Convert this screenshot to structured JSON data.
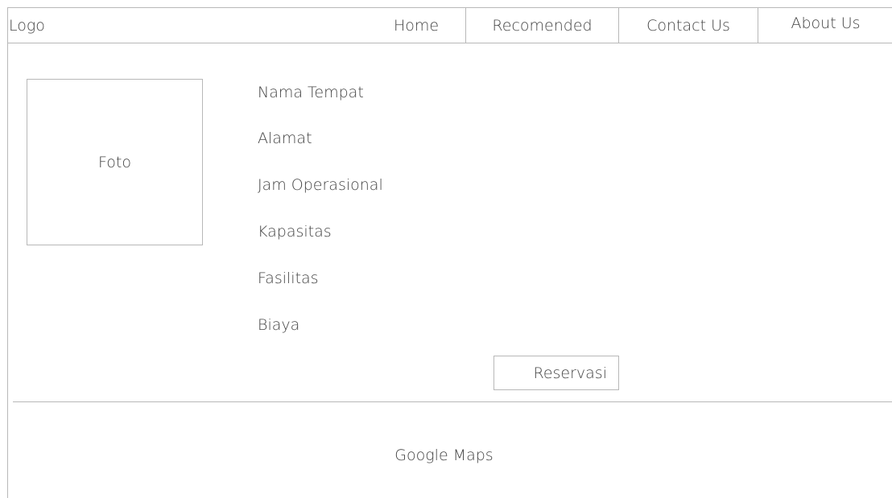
{
  "header": {
    "logo": "Logo",
    "nav": [
      {
        "label": "Home"
      },
      {
        "label": "Recomended"
      },
      {
        "label": "Contact Us"
      },
      {
        "label": "About Us"
      }
    ]
  },
  "main": {
    "photo_label": "Foto",
    "details": [
      "Nama Tempat",
      "Alamat",
      "Jam Operasional",
      "Kapasitas",
      "Fasilitas",
      "Biaya"
    ],
    "reserve_label": "Reservasi"
  },
  "footer": {
    "map_label": "Google Maps"
  },
  "colors": {
    "border": "#b8b8b8",
    "text": "#444444"
  }
}
